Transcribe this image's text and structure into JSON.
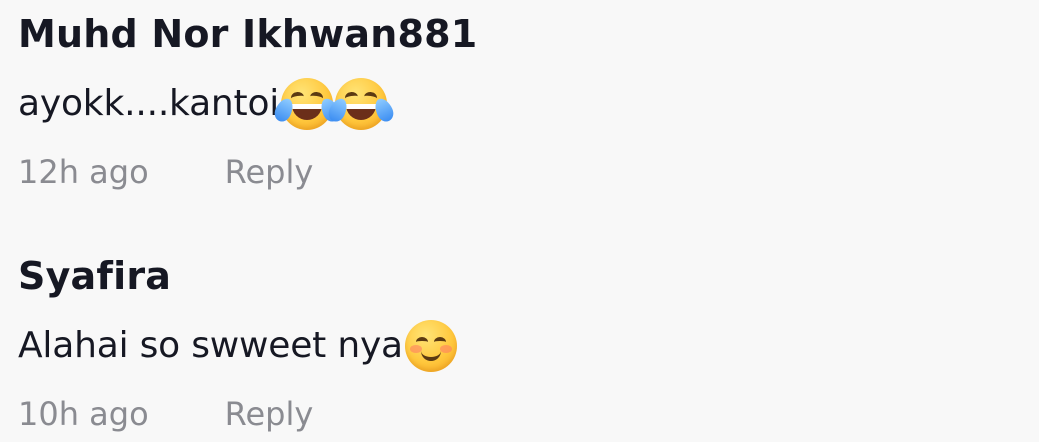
{
  "comments": [
    {
      "username": "Muhd Nor Ikhwan881",
      "text": "ayokk....kantoi",
      "emojis": [
        "face-with-tears-of-joy-icon",
        "face-with-tears-of-joy-icon"
      ],
      "time": "12h ago",
      "reply_label": "Reply"
    },
    {
      "username": "Syafira",
      "text": "Alahai so swweet nya",
      "emojis": [
        "smiling-face-with-smiling-eyes-icon"
      ],
      "time": "10h ago",
      "reply_label": "Reply"
    }
  ],
  "colors": {
    "background": "#f8f8f8",
    "username": "#161823",
    "text": "#161823",
    "meta": "#8a8b91"
  }
}
